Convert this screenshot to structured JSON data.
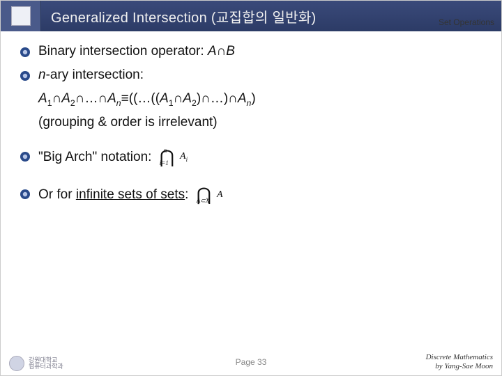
{
  "header": {
    "title": "Generalized Intersection (교집합의 일반화)",
    "topic": "Set Operations"
  },
  "body": {
    "bullet1_pre": "Binary intersection operator: ",
    "bullet1_math": "A∩B",
    "bullet2_pre": "",
    "bullet2_ital": "n",
    "bullet2_post": "-ary intersection:",
    "expr_line_a1": "A",
    "expr_line_s1": "1",
    "expr_line_cap": "∩",
    "expr_line_a2": "A",
    "expr_line_s2": "2",
    "expr_line_dots": "∩…∩",
    "expr_line_an": "A",
    "expr_line_sn": "n",
    "expr_line_eq": "≡((…((",
    "expr_line_ra1": "A",
    "expr_line_rs1": "1",
    "expr_line_rcap": "∩",
    "expr_line_ra2": "A",
    "expr_line_rs2": "2",
    "expr_line_rmid": ")∩…)∩",
    "expr_line_ran": "A",
    "expr_line_rsn": "n",
    "expr_line_rparen": ")",
    "grouping": "(grouping & order is irrelevant)",
    "bullet3": "\"Big Arch\" notation:",
    "bigarch_top": "n",
    "bigarch_sym": "⋂",
    "bigarch_bot": "i=1",
    "bigarch_rhs_a": "A",
    "bigarch_rhs_i": "i",
    "bullet4_pre": "Or for ",
    "bullet4_ul": "infinite sets of sets",
    "bullet4_post": ":",
    "inf_sym": "⋂",
    "inf_bot": "A⊂X",
    "inf_rhs": "A"
  },
  "footer": {
    "uni_line1": "강원대학교",
    "uni_line2": "컴퓨터과학과",
    "page": "Page 33",
    "credit1": "Discrete Mathematics",
    "credit2": "by Yang-Sae Moon"
  }
}
